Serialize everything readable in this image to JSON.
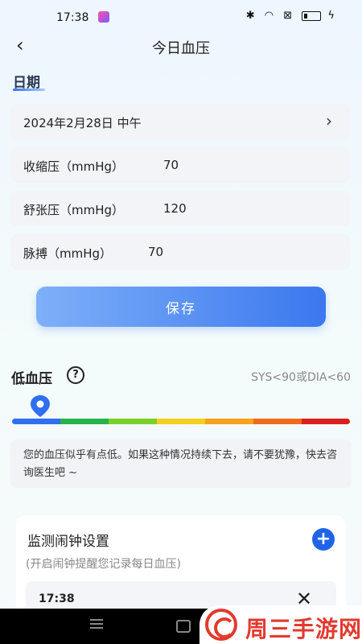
{
  "status_bar": {
    "time": "17:38"
  },
  "header": {
    "title": "今日血压"
  },
  "section": {
    "label": "日期"
  },
  "fields": {
    "date": {
      "value": "2024年2月28日 中午"
    },
    "systolic": {
      "label": "收缩压（mmHg）",
      "value": "70"
    },
    "diastolic": {
      "label": "舒张压（mmHg）",
      "value": "120"
    },
    "pulse": {
      "label": "脉搏（mmHg）",
      "value": "70"
    }
  },
  "save_label": "保存",
  "result": {
    "title": "低血压",
    "range": "SYS<90或DIA<60",
    "scale_colors": [
      "#2f6ff0",
      "#28b34a",
      "#7ccf2b",
      "#f4cf1e",
      "#f7a21b",
      "#f06a1c",
      "#d9201f"
    ],
    "advice": "您的血压似乎有点低。如果这种情况持续下去，请不要犹豫，快去咨询医生吧 ~"
  },
  "alarm": {
    "title": "监测闹钟设置",
    "subtitle": "(开启闹钟提醒您记录每日血压)",
    "items": [
      {
        "time": "17:38"
      }
    ]
  },
  "watermark": {
    "text": "周三手游网"
  }
}
